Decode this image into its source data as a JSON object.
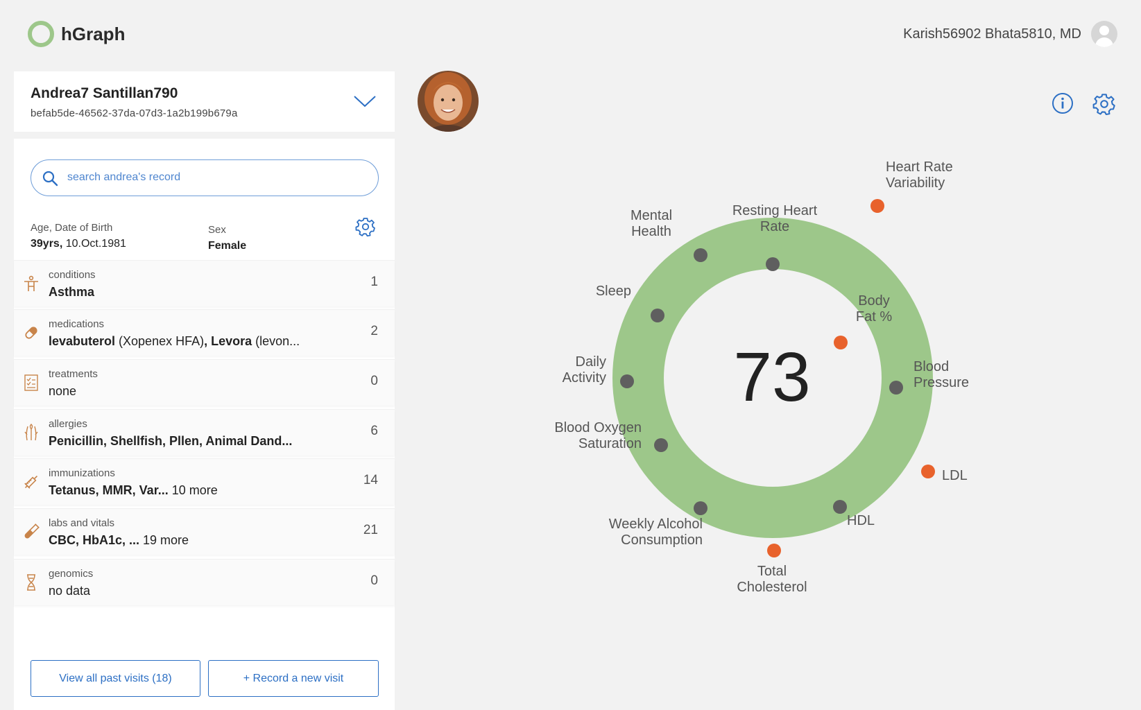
{
  "app": {
    "name": "hGraph"
  },
  "user": {
    "name": "Karish56902 Bhata5810, MD"
  },
  "patient": {
    "name": "Andrea7 Santillan790",
    "id": "befab5de-46562-37da-07d3-1a2b199b679a"
  },
  "search": {
    "placeholder": "search andrea's record"
  },
  "demographics": {
    "age_label": "Age, Date of Birth",
    "age_years": "39yrs,",
    "dob": " 10.Oct.1981",
    "sex_label": "Sex",
    "sex_value": "Female"
  },
  "categories": [
    {
      "label": "conditions",
      "icon": "person-icon",
      "count": "1",
      "value_html": [
        {
          "t": "Asthma",
          "b": true
        }
      ]
    },
    {
      "label": "medications",
      "icon": "pill-icon",
      "count": "2",
      "value_html": [
        {
          "t": "levabuterol",
          "b": true
        },
        {
          "t": " (Xopenex HFA)",
          "b": false
        },
        {
          "t": ", Levora",
          "b": true
        },
        {
          "t": " (levon...",
          "b": false
        }
      ]
    },
    {
      "label": "treatments",
      "icon": "checklist-icon",
      "count": "0",
      "value_html": [
        {
          "t": "none",
          "b": false
        }
      ]
    },
    {
      "label": "allergies",
      "icon": "wheat-icon",
      "count": "6",
      "value_html": [
        {
          "t": "Penicillin, Shellfish, Pllen, Animal Dand...",
          "b": true
        }
      ]
    },
    {
      "label": "immunizations",
      "icon": "syringe-icon",
      "count": "14",
      "value_html": [
        {
          "t": "Tetanus, MMR, Var...",
          "b": true
        },
        {
          "t": " 10 more",
          "b": false
        }
      ]
    },
    {
      "label": "labs and vitals",
      "icon": "test-tube-icon",
      "count": "21",
      "value_html": [
        {
          "t": "CBC, HbA1c, ...",
          "b": true
        },
        {
          "t": " 19 more",
          "b": false
        }
      ]
    },
    {
      "label": "genomics",
      "icon": "dna-icon",
      "count": "0",
      "value_html": [
        {
          "t": "no data",
          "b": false
        }
      ]
    }
  ],
  "buttons": {
    "past_visits": "View all past visits (18)",
    "new_visit": "+ Record a new visit"
  },
  "hgraph": {
    "score": "73",
    "ring_color": "#9dc78a",
    "normal_point_color": "#5f5f5f",
    "abnormal_point_color": "#e8622c",
    "metrics": [
      {
        "name": "Resting Heart Rate",
        "lines": [
          "Resting Heart",
          "Rate"
        ],
        "status": "normal"
      },
      {
        "name": "Heart Rate Variability",
        "lines": [
          "Heart Rate",
          "Variability"
        ],
        "status": "abnormal"
      },
      {
        "name": "Body Fat %",
        "lines": [
          "Body",
          "Fat %"
        ],
        "status": "abnormal"
      },
      {
        "name": "Blood Pressure",
        "lines": [
          "Blood",
          "Pressure"
        ],
        "status": "normal"
      },
      {
        "name": "LDL",
        "lines": [
          "LDL"
        ],
        "status": "abnormal"
      },
      {
        "name": "HDL",
        "lines": [
          "HDL"
        ],
        "status": "normal"
      },
      {
        "name": "Total Cholesterol",
        "lines": [
          "Total",
          "Cholesterol"
        ],
        "status": "abnormal"
      },
      {
        "name": "Weekly Alcohol Consumption",
        "lines": [
          "Weekly Alcohol",
          "Consumption"
        ],
        "status": "normal"
      },
      {
        "name": "Blood Oxygen Saturation",
        "lines": [
          "Blood Oxygen",
          "Saturation"
        ],
        "status": "normal"
      },
      {
        "name": "Daily Activity",
        "lines": [
          "Daily",
          "Activity"
        ],
        "status": "normal"
      },
      {
        "name": "Sleep",
        "lines": [
          "Sleep"
        ],
        "status": "normal"
      },
      {
        "name": "Mental Health",
        "lines": [
          "Mental",
          "Health"
        ],
        "status": "normal"
      }
    ]
  }
}
